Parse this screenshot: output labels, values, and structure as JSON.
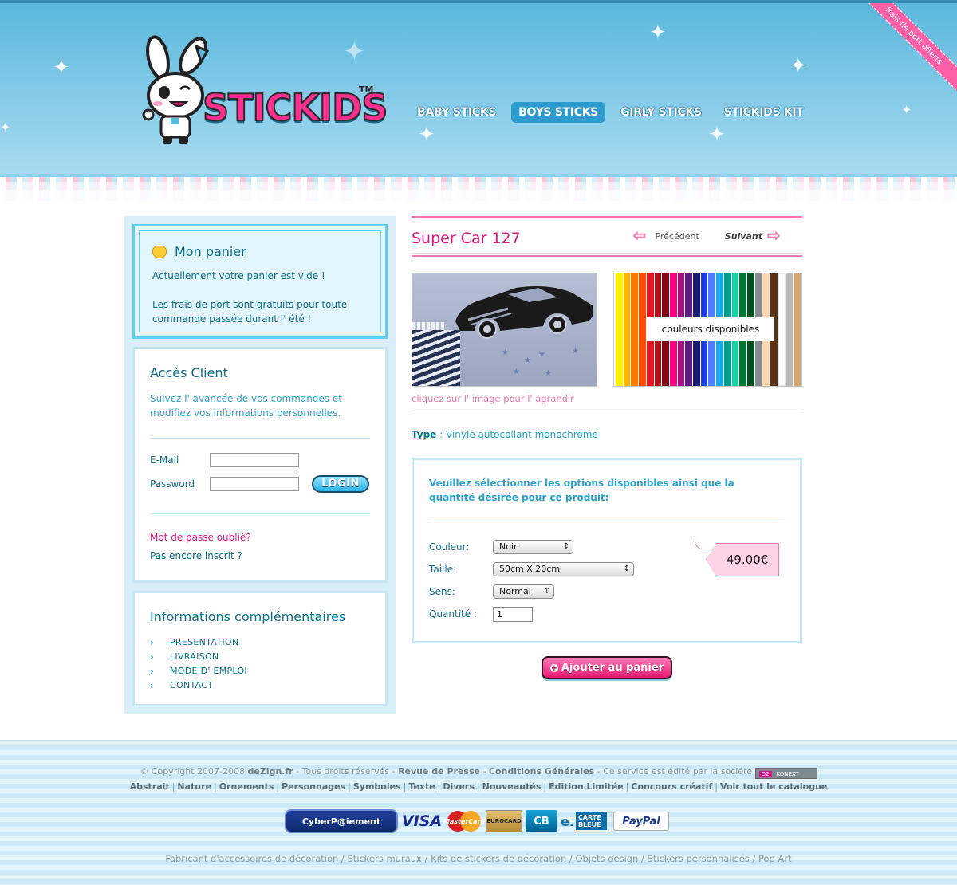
{
  "header": {
    "logo_text": "STICKIDS",
    "logo_tm": "TM",
    "ribbon_text": "frais de port offerts",
    "nav": [
      {
        "label": "BABY STICKS",
        "active": false
      },
      {
        "label": "BOYS STICKS",
        "active": true
      },
      {
        "label": "GIRLY STICKS",
        "active": false
      },
      {
        "label": "STICKIDS KIT",
        "active": false
      }
    ]
  },
  "cart": {
    "title": "Mon panier",
    "empty_message": "Actuellement votre panier est vide !",
    "shipping_message": "Les frais de port sont gratuits pour toute commande passée durant l' été !"
  },
  "access": {
    "title": "Accès Client",
    "description": "Suivez l' avancée de vos commandes et modifiez vos informations personnelles.",
    "email_label": "E-Mail",
    "email_value": "",
    "password_label": "Password",
    "password_value": "",
    "login_button": "LOGIN",
    "forgot_link": "Mot de passe oublié?",
    "register_link": "Pas encore inscrit ?"
  },
  "info": {
    "title": "Informations complémentaires",
    "links": [
      "PRESENTATION",
      "LIVRAISON",
      "MODE D' EMPLOI",
      "CONTACT"
    ]
  },
  "product": {
    "title": "Super Car 127",
    "prev_label": "Précédent",
    "next_label": "Suivant",
    "enlarge_hint": "cliquez sur l' image pour l' agrandir",
    "swatches_label": "couleurs disponibles",
    "swatch_colors": [
      "#fff200",
      "#ffb400",
      "#ff7800",
      "#ff4a00",
      "#e2141f",
      "#b1121f",
      "#7e0c14",
      "#ff007f",
      "#a3117f",
      "#5d1a83",
      "#1b1b75",
      "#1f3fe0",
      "#4f7dff",
      "#19a7e8",
      "#009c8c",
      "#1bd0a2",
      "#007a33",
      "#004f1f",
      "#878b8e",
      "#ffd8b0",
      "#5a3315",
      "#ffffff",
      "#b9b9b9",
      "#d6a671"
    ],
    "type_label": "Type",
    "type_value": "Vinyle autocollant monochrome"
  },
  "options": {
    "intro": "Veuillez sélectionner les options disponibles ainsi que la quantité désirée pour ce produit:",
    "color_label": "Couleur:",
    "color_value": "Noir",
    "size_label": "Taille:",
    "size_value": "50cm X 20cm",
    "direction_label": "Sens:",
    "direction_value": "Normal",
    "quantity_label": "Quantité :",
    "quantity_value": "1",
    "price": "49.00€"
  },
  "add_to_cart": "Ajouter au panier",
  "footer": {
    "copyright": "© Copyright 2007-2008",
    "site": "deZign.fr",
    "rights": " - Tous droits réservés - ",
    "press": "Revue de Presse",
    "sep": " - ",
    "terms": "Conditions Générales",
    "edited_by": " - Ce service est édité par la société",
    "konext_d2": "D2",
    "konext": "KONEXT",
    "categories": [
      "Abstrait",
      "Nature",
      "Ornements",
      "Personnages",
      "Symboles",
      "Texte",
      "Divers",
      "Nouveautés",
      "Edition Limitée",
      "Concours créatif",
      "Voir tout le catalogue"
    ],
    "payments": {
      "cyber": "CyberP@iement",
      "visa": "VISA",
      "mastercard": "MasterCard",
      "eurocard": "EUROCARD",
      "cb": "CB",
      "ecb_e": "e.",
      "ecb": "CARTE BLEUE",
      "paypal": "PayPal"
    },
    "seo_line": "Fabricant d'accessoires de décoration / Stickers muraux / Kits de stickers de décoration / Objets design / Stickers personnalisés / Pop Art"
  }
}
